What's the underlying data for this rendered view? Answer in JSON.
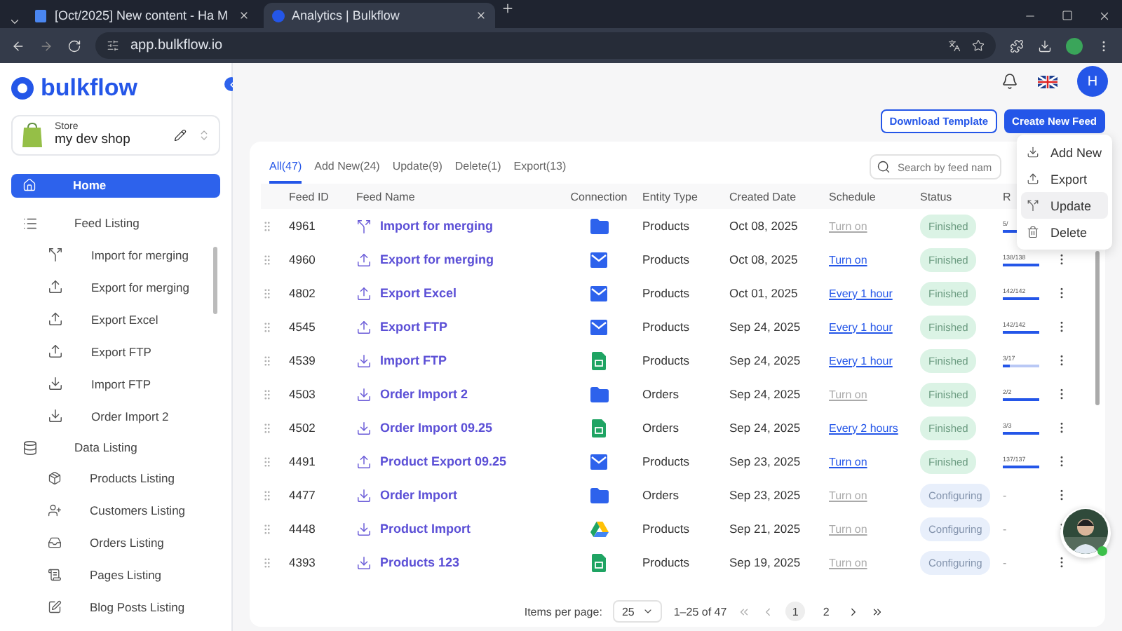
{
  "browser": {
    "tabs": [
      {
        "title": "[Oct/2025] New content - Ha M",
        "selected": false
      },
      {
        "title": "Analytics | Bulkflow",
        "selected": true
      }
    ],
    "url": "app.bulkflow.io"
  },
  "sidebar": {
    "logo": "bulkflow",
    "store": {
      "label": "Store",
      "name": "my dev shop"
    },
    "home": {
      "label": "Home",
      "selected": true
    },
    "feed_listing": {
      "label": "Feed Listing",
      "items": [
        {
          "label": "Import for merging",
          "kind": "merge"
        },
        {
          "label": "Export for merging",
          "kind": "export"
        },
        {
          "label": "Export Excel",
          "kind": "export"
        },
        {
          "label": "Export FTP",
          "kind": "export"
        },
        {
          "label": "Import FTP",
          "kind": "import"
        },
        {
          "label": "Order Import 2",
          "kind": "import"
        }
      ]
    },
    "data_listing": {
      "label": "Data Listing",
      "items": [
        {
          "label": "Products Listing",
          "kind": "products"
        },
        {
          "label": "Customers Listing",
          "kind": "customers"
        },
        {
          "label": "Orders Listing",
          "kind": "orders"
        },
        {
          "label": "Pages Listing",
          "kind": "pages"
        },
        {
          "label": "Blog Posts Listing",
          "kind": "blog"
        }
      ]
    }
  },
  "header": {
    "avatar": "H"
  },
  "actions": {
    "download_template": "Download Template",
    "create_new_feed": "Create New Feed",
    "menu": [
      {
        "label": "Add New",
        "kind": "import",
        "selected": false
      },
      {
        "label": "Export",
        "kind": "export",
        "selected": false
      },
      {
        "label": "Update",
        "kind": "merge",
        "selected": true
      },
      {
        "label": "Delete",
        "kind": "delete",
        "selected": false
      }
    ]
  },
  "filter_tabs": [
    {
      "label": "All(47)",
      "selected": true
    },
    {
      "label": "Add New(24)",
      "selected": false
    },
    {
      "label": "Update(9)",
      "selected": false
    },
    {
      "label": "Delete(1)",
      "selected": false
    },
    {
      "label": "Export(13)",
      "selected": false
    }
  ],
  "search": {
    "placeholder": "Search by feed nam"
  },
  "table": {
    "columns": [
      "Feed ID",
      "Feed Name",
      "Connection",
      "Entity Type",
      "Created Date",
      "Schedule",
      "Status",
      "R"
    ],
    "rows": [
      {
        "id": "4961",
        "name": "Import for merging",
        "kind": "merge",
        "connection": {
          "kind": "folder"
        },
        "entity": "Products",
        "created": "Oct 08, 2025",
        "schedule": {
          "text": "Turn on",
          "active": false
        },
        "status": {
          "text": "Finished",
          "kind": "finished"
        },
        "progress": {
          "text": "5/",
          "level": 1
        }
      },
      {
        "id": "4960",
        "name": "Export for merging",
        "kind": "export",
        "connection": {
          "kind": "mail"
        },
        "entity": "Products",
        "created": "Oct 08, 2025",
        "schedule": {
          "text": "Turn on",
          "active": true
        },
        "status": {
          "text": "Finished",
          "kind": "finished"
        },
        "progress": {
          "text": "138/138",
          "level": 1
        }
      },
      {
        "id": "4802",
        "name": "Export Excel",
        "kind": "export",
        "connection": {
          "kind": "mail"
        },
        "entity": "Products",
        "created": "Oct 01, 2025",
        "schedule": {
          "text": "Every 1 hour",
          "active": true
        },
        "status": {
          "text": "Finished",
          "kind": "finished"
        },
        "progress": {
          "text": "142/142",
          "level": 1
        }
      },
      {
        "id": "4545",
        "name": "Export FTP",
        "kind": "export",
        "connection": {
          "kind": "mail"
        },
        "entity": "Products",
        "created": "Sep 24, 2025",
        "schedule": {
          "text": "Every 1 hour",
          "active": true
        },
        "status": {
          "text": "Finished",
          "kind": "finished"
        },
        "progress": {
          "text": "142/142",
          "level": 1
        }
      },
      {
        "id": "4539",
        "name": "Import FTP",
        "kind": "import",
        "connection": {
          "kind": "sheet"
        },
        "entity": "Products",
        "created": "Sep 24, 2025",
        "schedule": {
          "text": "Every 1 hour",
          "active": true
        },
        "status": {
          "text": "Finished",
          "kind": "finished"
        },
        "progress": {
          "text": "3/17",
          "level": 0.18
        }
      },
      {
        "id": "4503",
        "name": "Order Import 2",
        "kind": "import",
        "connection": {
          "kind": "folder"
        },
        "entity": "Orders",
        "created": "Sep 24, 2025",
        "schedule": {
          "text": "Turn on",
          "active": false
        },
        "status": {
          "text": "Finished",
          "kind": "finished"
        },
        "progress": {
          "text": "2/2",
          "level": 1
        }
      },
      {
        "id": "4502",
        "name": "Order Import 09.25",
        "kind": "import",
        "connection": {
          "kind": "sheet"
        },
        "entity": "Orders",
        "created": "Sep 24, 2025",
        "schedule": {
          "text": "Every 2 hours",
          "active": true
        },
        "status": {
          "text": "Finished",
          "kind": "finished"
        },
        "progress": {
          "text": "3/3",
          "level": 1
        }
      },
      {
        "id": "4491",
        "name": "Product Export 09.25",
        "kind": "export",
        "connection": {
          "kind": "mail"
        },
        "entity": "Products",
        "created": "Sep 23, 2025",
        "schedule": {
          "text": "Turn on",
          "active": true
        },
        "status": {
          "text": "Finished",
          "kind": "finished"
        },
        "progress": {
          "text": "137/137",
          "level": 1
        }
      },
      {
        "id": "4477",
        "name": "Order Import",
        "kind": "import",
        "connection": {
          "kind": "folder"
        },
        "entity": "Orders",
        "created": "Sep 23, 2025",
        "schedule": {
          "text": "Turn on",
          "active": false
        },
        "status": {
          "text": "Configuring",
          "kind": "configuring"
        },
        "progress": {
          "text": "-"
        }
      },
      {
        "id": "4448",
        "name": "Product Import",
        "kind": "import",
        "connection": {
          "kind": "drive"
        },
        "entity": "Products",
        "created": "Sep 21, 2025",
        "schedule": {
          "text": "Turn on",
          "active": false
        },
        "status": {
          "text": "Configuring",
          "kind": "configuring"
        },
        "progress": {
          "text": "-"
        }
      },
      {
        "id": "4393",
        "name": "Products 123",
        "kind": "import",
        "connection": {
          "kind": "sheet"
        },
        "entity": "Products",
        "created": "Sep 19, 2025",
        "schedule": {
          "text": "Turn on",
          "active": false
        },
        "status": {
          "text": "Configuring",
          "kind": "configuring"
        },
        "progress": {
          "text": "-"
        }
      }
    ]
  },
  "pagination": {
    "label": "Items per page:",
    "per_page": "25",
    "range": "1–25 of 47",
    "pages": [
      {
        "label": "1",
        "selected": true
      },
      {
        "label": "2",
        "selected": false
      }
    ]
  }
}
